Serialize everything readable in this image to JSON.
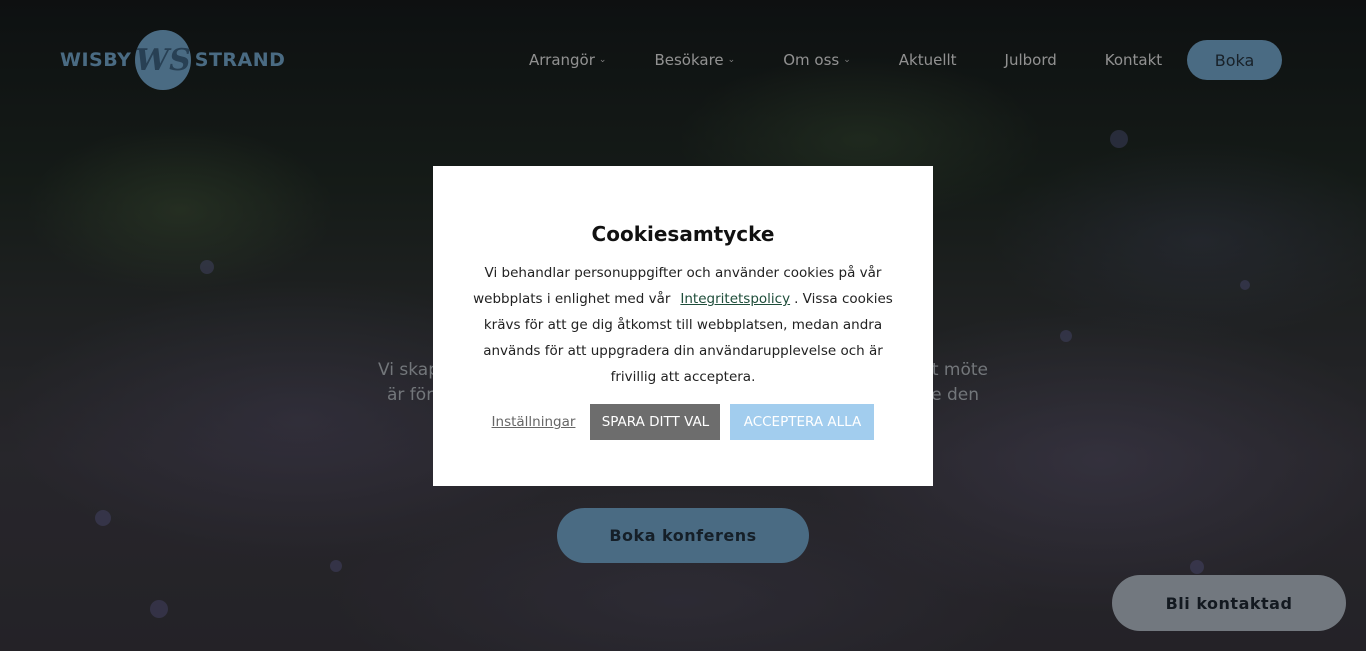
{
  "header": {
    "logo": {
      "left_word": "WISBY",
      "monogram": "WS",
      "right_word": "STRAND"
    },
    "nav": [
      {
        "label": "Arrangör",
        "has_dropdown": true
      },
      {
        "label": "Besökare",
        "has_dropdown": true
      },
      {
        "label": "Om oss",
        "has_dropdown": true
      },
      {
        "label": "Aktuellt",
        "has_dropdown": false
      },
      {
        "label": "Julbord",
        "has_dropdown": false
      },
      {
        "label": "Kontakt",
        "has_dropdown": false
      }
    ],
    "dropdown_icon": "chevron-down-icon",
    "book_label": "Boka"
  },
  "hero": {
    "line1_left": "Vi skap",
    "line1_right": "et möte",
    "line2_left": "är för",
    "line2_right": "e den",
    "cta_label": "Boka konferens"
  },
  "floating": {
    "contact_label": "Bli kontaktad"
  },
  "cookie_modal": {
    "title": "Cookiesamtycke",
    "text_before_link": "Vi behandlar personuppgifter och använder cookies på vår webbplats i enlighet med vår",
    "link_label": "Integritetspolicy",
    "text_after_link": ". Vissa cookies krävs för att ge dig åtkomst till webbplatsen, medan andra används för att uppgradera din användarupplevelse och är frivillig att acceptera.",
    "settings_label": "Inställningar",
    "save_label": "SPARA DITT VAL",
    "accept_label": "ACCEPTERA ALLA"
  },
  "colors": {
    "brand_blue": "#6e9ec2",
    "accept_button": "#a2cdee",
    "save_button": "#6d6d6d",
    "contact_button": "#a9b1bc"
  }
}
